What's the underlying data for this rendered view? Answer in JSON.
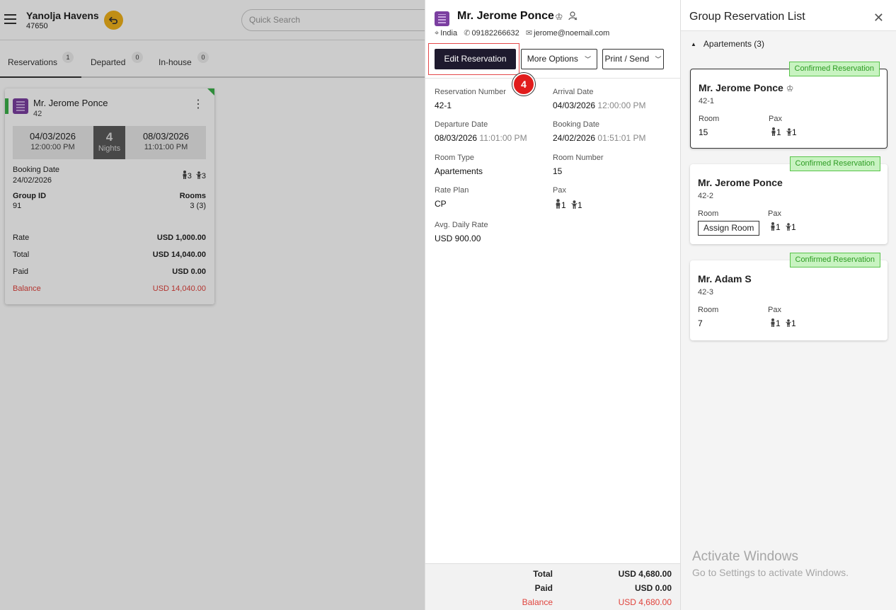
{
  "app": {
    "hotel_name": "Yanolja Havens",
    "hotel_id": "47650",
    "search_placeholder": "Quick Search"
  },
  "tabs": [
    {
      "label": "Reservations",
      "count": "1"
    },
    {
      "label": "Departed",
      "count": "0"
    },
    {
      "label": "In-house",
      "count": "0"
    }
  ],
  "reservation_card": {
    "guest": "Mr. Jerome Ponce",
    "number": "42",
    "arrival_date": "04/03/2026",
    "arrival_time": "12:00:00 PM",
    "nights_count": "4",
    "nights_label": "Nights",
    "departure_date": "08/03/2026",
    "departure_time": "11:01:00 PM",
    "booking_date_label": "Booking Date",
    "booking_date": "24/02/2026",
    "adults": "3",
    "children": "3",
    "group_id_label": "Group ID",
    "group_id": "91",
    "rooms_label": "Rooms",
    "rooms": "3 (3)",
    "rate_label": "Rate",
    "rate": "USD 1,000.00",
    "total_label": "Total",
    "total": "USD 14,040.00",
    "paid_label": "Paid",
    "paid": "USD 0.00",
    "balance_label": "Balance",
    "balance": "USD 14,040.00"
  },
  "detail": {
    "guest_name": "Mr. Jerome Ponce",
    "country": "India",
    "phone": "09182266632",
    "email": "jerome@noemail.com",
    "edit_label": "Edit Reservation",
    "more_label": "More Options",
    "print_label": "Print / Send",
    "step_number": "4",
    "fields": {
      "res_number_label": "Reservation Number",
      "res_number": "42-1",
      "arrival_label": "Arrival Date",
      "arrival_date": "04/03/2026",
      "arrival_time": "12:00:00 PM",
      "departure_label": "Departure Date",
      "departure_date": "08/03/2026",
      "departure_time": "11:01:00 PM",
      "booking_label": "Booking Date",
      "booking_date": "24/02/2026",
      "booking_time": "01:51:01 PM",
      "room_type_label": "Room Type",
      "room_type": "Apartements",
      "room_number_label": "Room Number",
      "room_number": "15",
      "rate_plan_label": "Rate Plan",
      "rate_plan": "CP",
      "pax_label": "Pax",
      "adults": "1",
      "children": "1",
      "avg_rate_label": "Avg. Daily Rate",
      "avg_rate": "USD 900.00"
    },
    "footer": {
      "total_label": "Total",
      "total": "USD 4,680.00",
      "paid_label": "Paid",
      "paid": "USD 0.00",
      "balance_label": "Balance",
      "balance": "USD 4,680.00"
    }
  },
  "group": {
    "title": "Group Reservation List",
    "section": "Apartements (3)",
    "room_label": "Room",
    "pax_label": "Pax",
    "items": [
      {
        "status": "Confirmed Reservation",
        "name": "Mr. Jerome Ponce",
        "res": "42-1",
        "room": "15",
        "adults": "1",
        "children": "1"
      },
      {
        "status": "Confirmed Reservation",
        "name": "Mr. Jerome Ponce",
        "res": "42-2",
        "assign_label": "Assign Room",
        "adults": "1",
        "children": "1"
      },
      {
        "status": "Confirmed Reservation",
        "name": "Mr. Adam S",
        "res": "42-3",
        "room": "7",
        "adults": "1",
        "children": "1"
      }
    ]
  },
  "watermark": {
    "line1": "Activate Windows",
    "line2": "Go to Settings to activate Windows."
  },
  "colors": {
    "primary_button": "#1e1a2e",
    "confirmed_bg": "#c8f3c1",
    "confirmed_text": "#2e9c24",
    "balance_red": "#e0433c",
    "back_button": "#f0b21b",
    "step_badge": "#e11d1d"
  }
}
